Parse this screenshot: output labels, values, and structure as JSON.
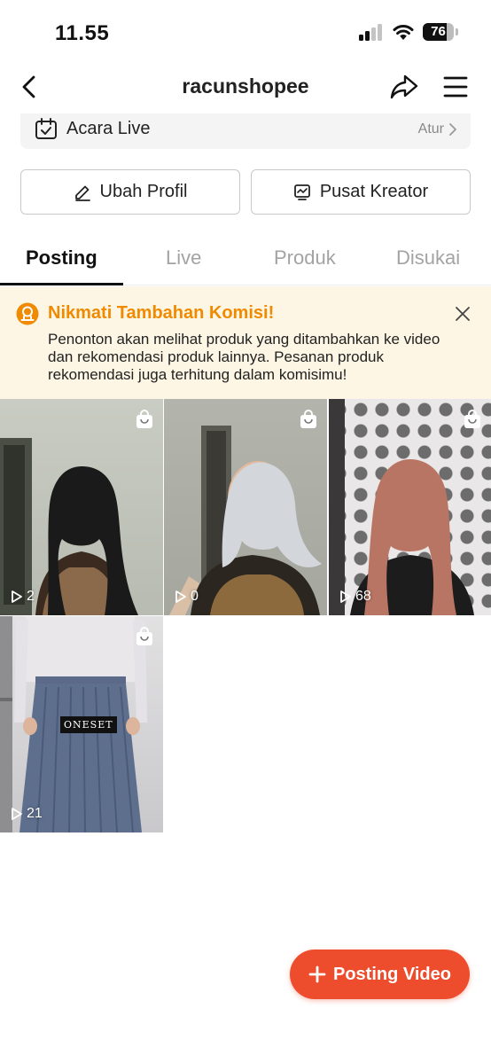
{
  "status_bar": {
    "time": "11.55",
    "battery": "76",
    "battery_level": 0.76
  },
  "header": {
    "title": "racunshopee",
    "icons": {
      "back": "chevron-left-icon",
      "share": "share-icon",
      "menu": "hamburger-menu-icon"
    }
  },
  "acara_live": {
    "label": "Acara Live",
    "action": "Atur",
    "icon": "calendar-check-icon"
  },
  "profile_buttons": {
    "edit": {
      "label": "Ubah Profil",
      "icon": "pencil-icon"
    },
    "creator": {
      "label": "Pusat Kreator",
      "icon": "chart-monitor-icon"
    }
  },
  "tabs": [
    {
      "label": "Posting",
      "active": true
    },
    {
      "label": "Live",
      "active": false
    },
    {
      "label": "Produk",
      "active": false
    },
    {
      "label": "Disukai",
      "active": false
    }
  ],
  "promo": {
    "title": "Nikmati Tambahan Komisi!",
    "body": "Penonton akan melihat produk yang ditambahkan ke video dan rekomendasi produk lainnya. Pesanan produk rekomendasi juga terhitung dalam komisimu!",
    "accent": "#f08a00",
    "background": "#fdf6e4"
  },
  "videos": [
    {
      "views": "2",
      "hijab_color": "#1a1a1a"
    },
    {
      "views": "0",
      "hijab_color": "#d3d6db"
    },
    {
      "views": "68",
      "hijab_color": "#b97563"
    },
    {
      "views": "21",
      "overlay_text": "ONESET"
    }
  ],
  "fab": {
    "label": "Posting Video",
    "color": "#ee4d2d"
  }
}
